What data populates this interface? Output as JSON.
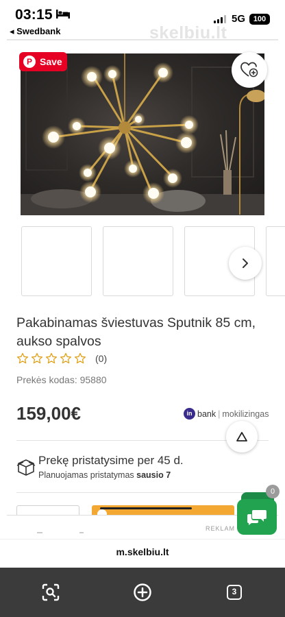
{
  "status_bar": {
    "time": "03:15",
    "back_app": "◂ Swedbank",
    "network": "5G",
    "battery": "100",
    "watermark": "skelbiu.lt"
  },
  "hero": {
    "save_label": "Save",
    "pin_glyph": "P"
  },
  "product": {
    "title": "Pakabinamas šviestuvas Sputnik 85 cm, aukso spalvos",
    "rating_stars": 0,
    "rating_max": 5,
    "rating_count": "(0)",
    "code": "Prekės kodas: 95880",
    "price": "159,00€"
  },
  "bank": {
    "logo_text": "in",
    "name": "bank",
    "separator": "|",
    "tagline": "mokilizingas"
  },
  "delivery": {
    "main": "Prekę pristatysime per 45 d.",
    "sub_prefix": "Planuojamas pristatymas ",
    "sub_date": "sausio 7"
  },
  "ad": {
    "label": "REKLAM"
  },
  "chat": {
    "count": "0"
  },
  "browser": {
    "url": "m.skelbiu.lt",
    "tabs_count": "3"
  },
  "icons": {
    "favorite": "heart-plus-icon",
    "next": "chevron-right-icon",
    "scroll_top": "chevron-up-icon",
    "delivery": "box-icon",
    "chat": "chat-bubbles-icon",
    "lens": "camera-search-icon",
    "new_tab": "plus-circle-icon"
  },
  "colors": {
    "pinterest_red": "#e60023",
    "chat_green": "#22a34f",
    "banner_orange": "#f3a833",
    "bank_purple": "#3a2c8c"
  }
}
